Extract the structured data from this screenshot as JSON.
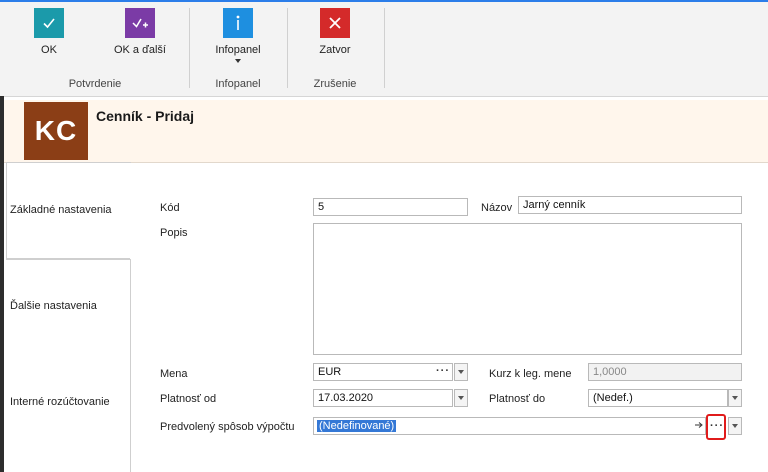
{
  "ribbon": {
    "buttons": [
      {
        "label": "OK",
        "icon": "check-icon",
        "color": "#1b9aaa"
      },
      {
        "label": "OK a ďalší",
        "icon": "check-plus-icon",
        "color": "#7b3ba6"
      },
      {
        "label": "Infopanel",
        "icon": "info-icon",
        "color": "#1e8fe0"
      },
      {
        "label": "Zatvor",
        "icon": "close-icon",
        "color": "#d42a2a"
      }
    ],
    "groups": [
      "Potvrdenie",
      "Infopanel",
      "Zrušenie"
    ]
  },
  "header": {
    "logo": "KC",
    "logo_color": "#8b3e16",
    "title": "Cenník - Pridaj"
  },
  "tabs": [
    {
      "label": "Základné nastavenia",
      "active": true
    },
    {
      "label": "Ďalšie nastavenia",
      "active": false
    },
    {
      "label": "Interné rozúčtovanie",
      "active": false
    }
  ],
  "form": {
    "kod_label": "Kód",
    "kod_value": "5",
    "nazov_label": "Názov",
    "nazov_value": "Jarný cenník",
    "popis_label": "Popis",
    "mena_label": "Mena",
    "mena_value": "EUR",
    "kurz_label": "Kurz k leg. mene",
    "kurz_value": "1,0000",
    "platnost_od_label": "Platnosť od",
    "platnost_od_value": "17.03.2020",
    "platnost_do_label": "Platnosť do",
    "platnost_do_value": "(Nedef.)",
    "sposob_label": "Predvolený spôsob výpočtu",
    "sposob_value": "(Nedefinované)"
  }
}
